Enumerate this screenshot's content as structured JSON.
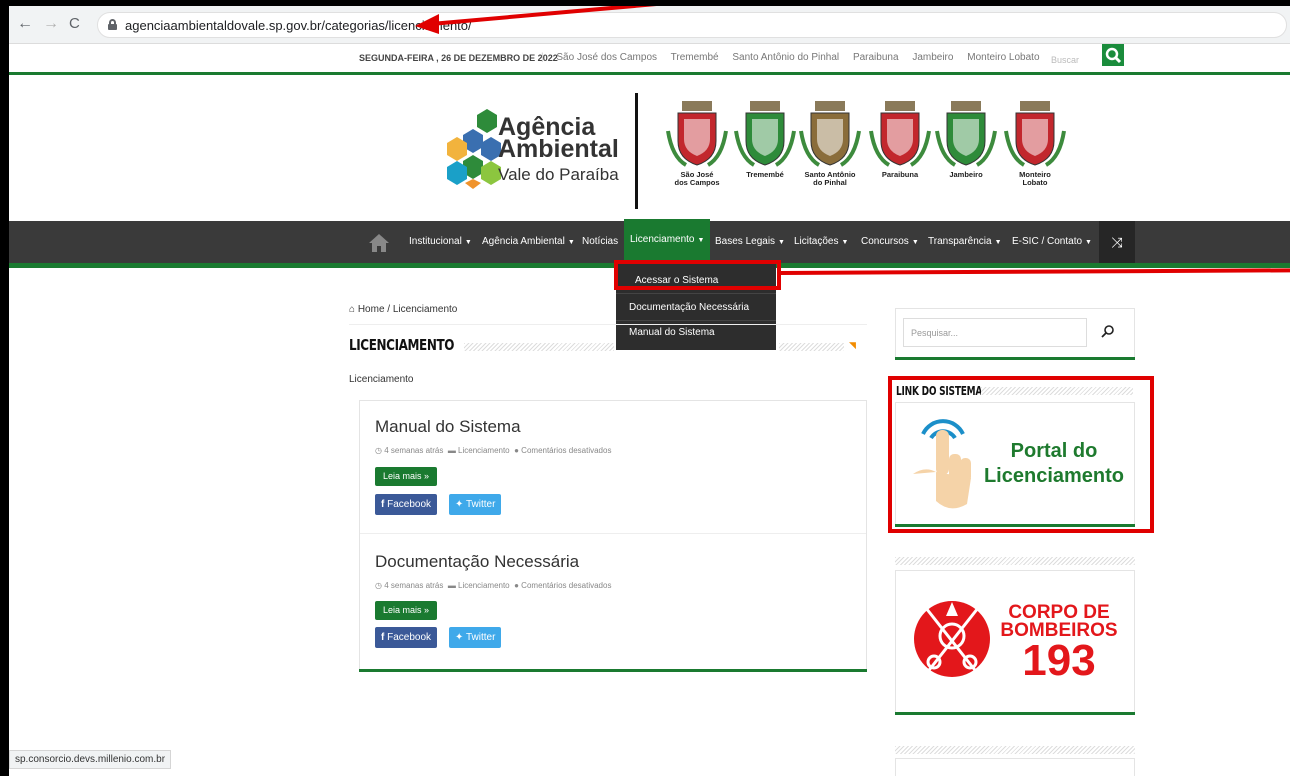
{
  "browser": {
    "url": "agenciaambientaldovale.sp.gov.br/categorias/licenciamento/",
    "status_url": "sp.consorcio.devs.millenio.com.br"
  },
  "topbar": {
    "date": "SEGUNDA-FEIRA , 26 DE DEZEMBRO DE 2022",
    "cities": [
      "São José dos Campos",
      "Tremembé",
      "Santo Antônio do Pinhal",
      "Paraibuna",
      "Jambeiro",
      "Monteiro Lobato"
    ],
    "search_placeholder": "Buscar"
  },
  "header": {
    "logo_line1": "Agência",
    "logo_line2": "Ambiental",
    "logo_line3": "Vale do Paraíba",
    "crests": [
      "São José dos Campos",
      "Tremembé",
      "Santo Antônio do Pinhal",
      "Paraibuna",
      "Jambeiro",
      "Monteiro Lobato"
    ],
    "crest_line1": [
      "São José",
      "Tremembé",
      "Santo Antônio",
      "Paraibuna",
      "Jambeiro",
      "Monteiro"
    ],
    "crest_line2": [
      "dos Campos",
      "",
      "do Pinhal",
      "",
      "",
      "Lobato"
    ],
    "crest_colors": [
      "#c2272d",
      "#2e8b3a",
      "#8a6d3b",
      "#c2272d",
      "#2e8b3a",
      "#c2272d"
    ]
  },
  "nav": {
    "items": [
      "Institucional",
      "Agência Ambiental",
      "Notícias",
      "Licenciamento",
      "Bases Legais",
      "Licitações",
      "Concursos",
      "Transparência",
      "E-SIC / Contato"
    ],
    "dropdown": [
      "Acessar o Sistema",
      "Documentação Necessária",
      "Manual do Sistema"
    ]
  },
  "breadcrumb": {
    "home": "Home",
    "current": "Licenciamento",
    "sep": " / "
  },
  "page": {
    "title": "LICENCIAMENTO",
    "description": "Licenciamento"
  },
  "posts": [
    {
      "title": "Manual do Sistema",
      "time": "4 semanas atrás",
      "category": "Licenciamento",
      "comments": "Comentários desativados",
      "read_more": "Leia mais »",
      "facebook": "Facebook",
      "twitter": "Twitter"
    },
    {
      "title": "Documentação Necessária",
      "time": "4 semanas atrás",
      "category": "Licenciamento",
      "comments": "Comentários desativados",
      "read_more": "Leia mais »",
      "facebook": "Facebook",
      "twitter": "Twitter"
    }
  ],
  "sidebar": {
    "search_placeholder": "Pesquisar...",
    "link_widget_title": "LINK DO SISTEMA",
    "portal_line1": "Portal do",
    "portal_line2": "Licenciamento",
    "bombeiros_line1": "CORPO DE",
    "bombeiros_line2": "BOMBEIROS",
    "bombeiros_number": "193"
  },
  "colors": {
    "brand_green": "#1a7a30",
    "nav_dark": "#3a3a3a",
    "annotation_red": "#e00000"
  }
}
